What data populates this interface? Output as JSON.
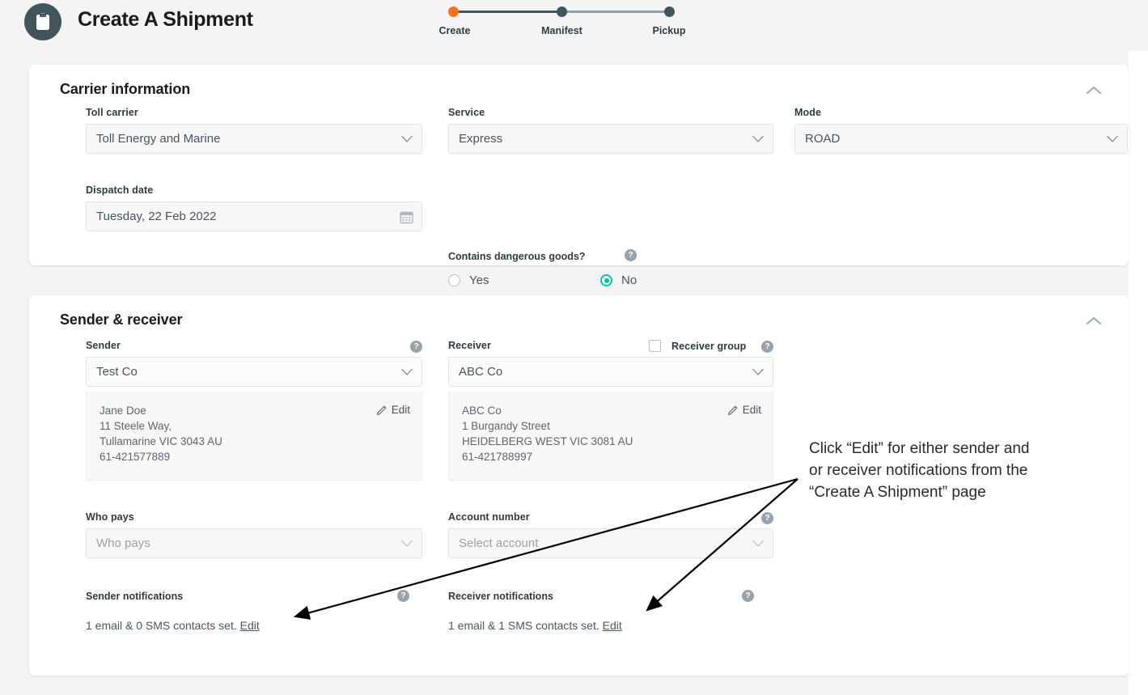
{
  "header": {
    "title": "Create A Shipment",
    "icon": "clipboard-icon",
    "stepper": {
      "steps": [
        {
          "label": "Create",
          "state": "current"
        },
        {
          "label": "Manifest",
          "state": "upcoming"
        },
        {
          "label": "Pickup",
          "state": "upcoming"
        }
      ],
      "current_color": "#f97316",
      "step_color": "#41555d"
    }
  },
  "carrier_card": {
    "title": "Carrier information",
    "collapse_icon": "chevron-up-icon",
    "toll_carrier": {
      "label": "Toll carrier",
      "value": "Toll Energy and Marine"
    },
    "service": {
      "label": "Service",
      "value": "Express"
    },
    "mode": {
      "label": "Mode",
      "value": "ROAD"
    },
    "dispatch_date": {
      "label": "Dispatch date",
      "value": "Tuesday, 22 Feb 2022",
      "icon": "calendar-icon"
    },
    "dangerous_goods": {
      "label": "Contains dangerous goods?",
      "help_icon": "help-icon",
      "options": [
        {
          "label": "Yes",
          "selected": false
        },
        {
          "label": "No",
          "selected": true
        }
      ],
      "selected_color": "#0bbfa5"
    }
  },
  "sender_card": {
    "title": "Sender & receiver",
    "collapse_icon": "chevron-up-icon",
    "sender": {
      "label": "Sender",
      "help_icon": "help-icon",
      "value": "Test Co",
      "edit_label": "Edit",
      "edit_icon": "pencil-icon",
      "address": [
        "Jane Doe",
        "11 Steele Way,",
        "Tullamarine VIC 3043 AU",
        "61-421577889"
      ]
    },
    "receiver": {
      "label": "Receiver",
      "help_icon": "help-icon",
      "group_label": "Receiver group",
      "group_checked": false,
      "value": "ABC Co",
      "edit_label": "Edit",
      "edit_icon": "pencil-icon",
      "address": [
        "ABC Co",
        "1 Burgandy Street",
        "HEIDELBERG WEST VIC 3081 AU",
        "61-421788997"
      ]
    },
    "who_pays": {
      "label": "Who pays",
      "placeholder": "Who pays",
      "value": ""
    },
    "account_number": {
      "label": "Account number",
      "placeholder": "Select account",
      "value": "",
      "help_icon": "help-icon"
    },
    "sender_notifications": {
      "label": "Sender notifications",
      "help_icon": "help-icon",
      "summary": "1 email & 0 SMS contacts set.",
      "edit_label": "Edit"
    },
    "receiver_notifications": {
      "label": "Receiver notifications",
      "help_icon": "help-icon",
      "summary": "1 email & 1 SMS contacts set.",
      "edit_label": "Edit"
    }
  },
  "annotation": {
    "line1": "Click “Edit” for either sender and",
    "line2": "or receiver notifications from the",
    "line3": "“Create A Shipment” page",
    "arrows": 2,
    "arrow_color": "#000000"
  }
}
